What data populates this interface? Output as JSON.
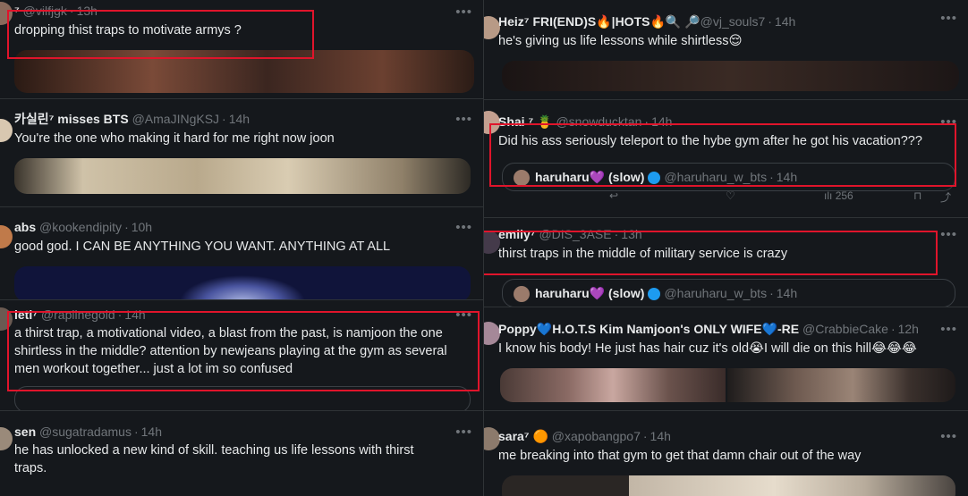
{
  "left": {
    "t1": {
      "name": "⁷",
      "handle": "@vilfjgk",
      "time": "13h",
      "text": "dropping thist traps to motivate armys ?"
    },
    "t2": {
      "name": "카실린⁷ misses BTS",
      "handle": "@AmaJINgKSJ",
      "time": "14h",
      "text": "You're the one who making it hard for me right now joon"
    },
    "t3": {
      "name": "abs",
      "handle": "@kookendipity",
      "time": "10h",
      "text": "good god. I CAN BE ANYTHING YOU WANT. ANYTHING AT ALL"
    },
    "t4": {
      "name": "leti⁷",
      "handle": "@raplinegold",
      "time": "14h",
      "text": "a thirst trap, a motivational video, a blast from the past, is namjoon the one shirtless in the middle? attention by newjeans playing at the gym as several men workout together... just a lot im so confused"
    },
    "t5": {
      "name": "sen",
      "handle": "@sugatradamus",
      "time": "14h",
      "text": "he has unlocked a new kind of skill. teaching us life lessons with thirst traps."
    }
  },
  "right": {
    "t1": {
      "name": "Heiz⁷ FRI(END)S🔥|HOTS🔥🔍",
      "handle": "🔎@vj_souls7",
      "time": "14h",
      "text": "he's giving us life lessons while shirtless😌"
    },
    "t2": {
      "name": "Shai ⁷ 🍍",
      "handle": "@snowducktan",
      "time": "14h",
      "text": "Did his ass seriously teleport to the hybe gym after he got his vacation???",
      "quote_name": "haruharu💜 (slow)",
      "quote_handle": "@haruharu_w_bts",
      "quote_time": "14h",
      "counts": "256"
    },
    "t3": {
      "name": "emily⁷",
      "handle": "@DIS_3ASE",
      "time": "13h",
      "text": "thirst traps in the middle of military service is crazy",
      "quote_name": "haruharu💜 (slow)",
      "quote_handle": "@haruharu_w_bts",
      "quote_time": "14h"
    },
    "t4": {
      "name": "Poppy💙H.O.T.S Kim Namjoon's ONLY WIFE💙-RE",
      "handle": "@CrabbieCake",
      "time": "12h",
      "text": "I know his body! He just has hair cuz it's old😭I will die on this hill😂😂😂"
    },
    "t5": {
      "name": "sara⁷ 🟠",
      "handle": "@xapobangpo7",
      "time": "14h",
      "text": "me breaking into that gym to get that damn chair out of the way"
    }
  },
  "more_label": "•••",
  "sep": "·",
  "colors": {
    "bg": "#15181c",
    "text": "#e7e9ea",
    "muted": "#71767b",
    "highlight": "#e0142b",
    "verified": "#1d9bf0"
  }
}
